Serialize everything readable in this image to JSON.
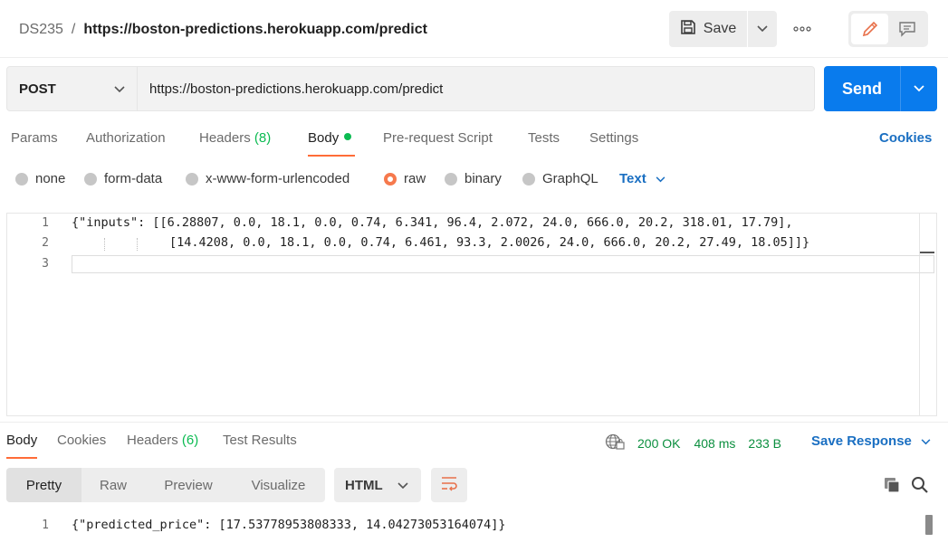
{
  "header": {
    "workspace": "DS235",
    "separator": "/",
    "request_name": "https://boston-predictions.herokuapp.com/predict",
    "save_label": "Save",
    "icons": {
      "save": "floppy-disk-icon",
      "more": "ellipsis-icon",
      "edit": "pencil-icon",
      "comments": "comment-icon"
    }
  },
  "request": {
    "method": "POST",
    "url": "https://boston-predictions.herokuapp.com/predict",
    "send_label": "Send"
  },
  "request_tabs": [
    {
      "label": "Params"
    },
    {
      "label": "Authorization"
    },
    {
      "label": "Headers",
      "count": "(8)"
    },
    {
      "label": "Body",
      "active": true
    },
    {
      "label": "Pre-request Script"
    },
    {
      "label": "Tests"
    },
    {
      "label": "Settings"
    }
  ],
  "cookies_label": "Cookies",
  "body_types": [
    {
      "label": "none"
    },
    {
      "label": "form-data"
    },
    {
      "label": "x-www-form-urlencoded"
    },
    {
      "label": "raw",
      "selected": true
    },
    {
      "label": "binary"
    },
    {
      "label": "GraphQL"
    }
  ],
  "body_language": "Text",
  "request_body": {
    "lines": [
      {
        "num": "1",
        "text": "{\"inputs\": [[6.28807, 0.0, 18.1, 0.0, 0.74, 6.341, 96.4, 2.072, 24.0, 666.0, 20.2, 318.01, 17.79],"
      },
      {
        "num": "2",
        "text": "[14.4208, 0.0, 18.1, 0.0, 0.74, 6.461, 93.3, 2.0026, 24.0, 666.0, 20.2, 27.49, 18.05]]}"
      },
      {
        "num": "3",
        "text": ""
      }
    ]
  },
  "response_tabs": [
    {
      "label": "Body",
      "active": true
    },
    {
      "label": "Cookies"
    },
    {
      "label": "Headers",
      "count": "(6)"
    },
    {
      "label": "Test Results"
    }
  ],
  "response_status": {
    "status": "200 OK",
    "time": "408 ms",
    "size": "233 B",
    "save_label": "Save Response"
  },
  "response_views": [
    {
      "label": "Pretty",
      "active": true
    },
    {
      "label": "Raw"
    },
    {
      "label": "Preview"
    },
    {
      "label": "Visualize"
    }
  ],
  "response_format": "HTML",
  "response_body": {
    "lines": [
      {
        "num": "1",
        "text": "{\"predicted_price\": [17.53778953808333, 14.04273053164074]}"
      }
    ]
  },
  "colors": {
    "accent_orange": "#ff6c37",
    "send_blue": "#097bed",
    "link_blue": "#1a6fc2",
    "status_green": "#0c8f3f",
    "count_green": "#0cbb52"
  }
}
